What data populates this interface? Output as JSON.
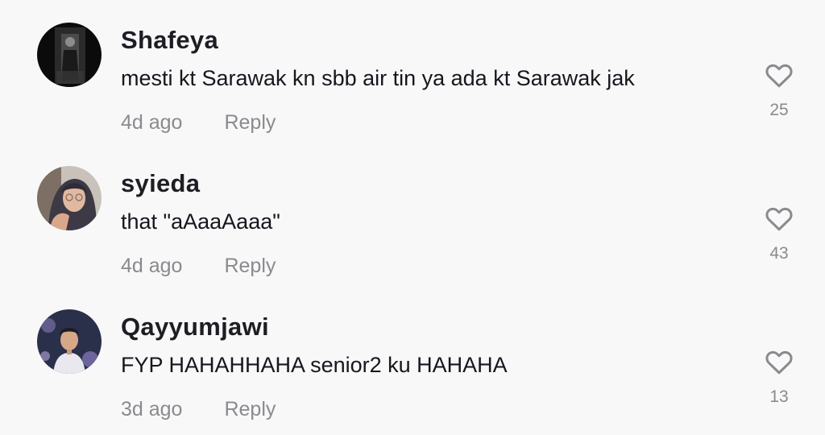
{
  "comments": [
    {
      "username": "Shafeya",
      "text": "mesti kt Sarawak kn sbb air tin ya ada kt Sarawak jak",
      "time": "4d ago",
      "reply_label": "Reply",
      "likes": "25"
    },
    {
      "username": "syieda",
      "text": "that \"aAaaAaaa\"",
      "time": "4d ago",
      "reply_label": "Reply",
      "likes": "43"
    },
    {
      "username": "Qayyumjawi",
      "text": "FYP HAHAHHAHA senior2 ku HAHAHA",
      "time": "3d ago",
      "reply_label": "Reply",
      "likes": "13"
    }
  ],
  "icons": {
    "like": "heart-outline-icon"
  },
  "colors": {
    "background": "#f8f8f8",
    "username": "#1d1d24",
    "secondary_text": "#8a8a8f"
  }
}
